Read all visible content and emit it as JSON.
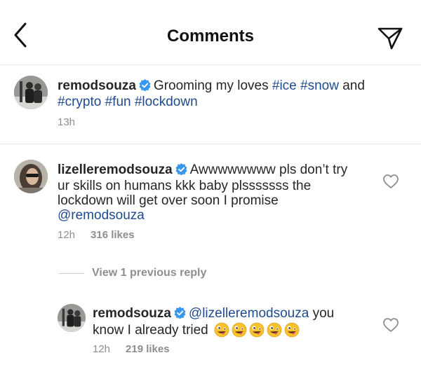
{
  "header": {
    "title": "Comments"
  },
  "caption": {
    "username": "remodsouza",
    "text_plain": "Grooming my loves",
    "hashtags_line1": [
      "#ice",
      "#snow"
    ],
    "connector": "and",
    "hashtags_line2": [
      "#crypto",
      "#fun",
      "#lockdown"
    ],
    "time": "13h"
  },
  "comment": {
    "username": "lizelleremodsouza",
    "line1": "Awwwwwwww pls don’t try",
    "line2": "ur skills on humans kkk baby plsssssss the",
    "line3": "lockdown will get over soon I promise",
    "mention": "@remodsouza",
    "time": "12h",
    "likes": "316 likes"
  },
  "view_previous": "View 1 previous reply",
  "reply": {
    "username": "remodsouza",
    "mention": "@lizelleremodsouza",
    "text1": "you",
    "text2": "know I already tried",
    "emoji_count": 5,
    "emoji_name": "zany-face-emoji",
    "time": "12h",
    "likes": "219 likes"
  },
  "colors": {
    "link": "#1f4b8e",
    "verified": "#3897f0",
    "muted": "#8e8e8e"
  },
  "icons": [
    "back-chevron-icon",
    "send-icon",
    "verified-icon",
    "heart-icon"
  ]
}
